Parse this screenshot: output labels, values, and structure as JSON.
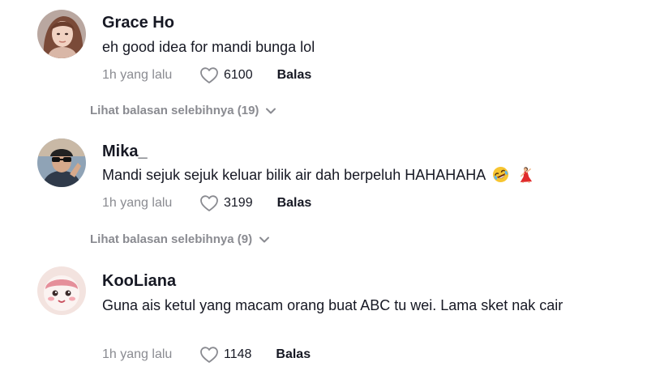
{
  "comments": [
    {
      "username": "Grace Ho",
      "text": "eh good idea for mandi bunga lol",
      "time": "1h yang lalu",
      "likes": "6100",
      "reply": "Balas",
      "more_replies": "Lihat balasan selebihnya (19)"
    },
    {
      "username": "Mika_",
      "text": "Mandi sejuk sejuk keluar bilik air dah berpeluh HAHAHAHA",
      "emojis": [
        "rolling-on-floor-laughing-emoji",
        "dancing-woman-emoji"
      ],
      "time": "1h yang lalu",
      "likes": "3199",
      "reply": "Balas",
      "more_replies": "Lihat balasan selebihnya (9)"
    },
    {
      "username": "KooLiana",
      "text": "Guna ais ketul yang macam orang buat ABC tu wei. Lama sket nak cair",
      "time": "1h yang lalu",
      "likes": "1148",
      "reply": "Balas"
    }
  ],
  "icons": {
    "like": "heart-outline-icon",
    "expand": "chevron-down-icon"
  },
  "colors": {
    "text": "#161823",
    "secondary": "#8a8b91",
    "background": "#ffffff"
  }
}
